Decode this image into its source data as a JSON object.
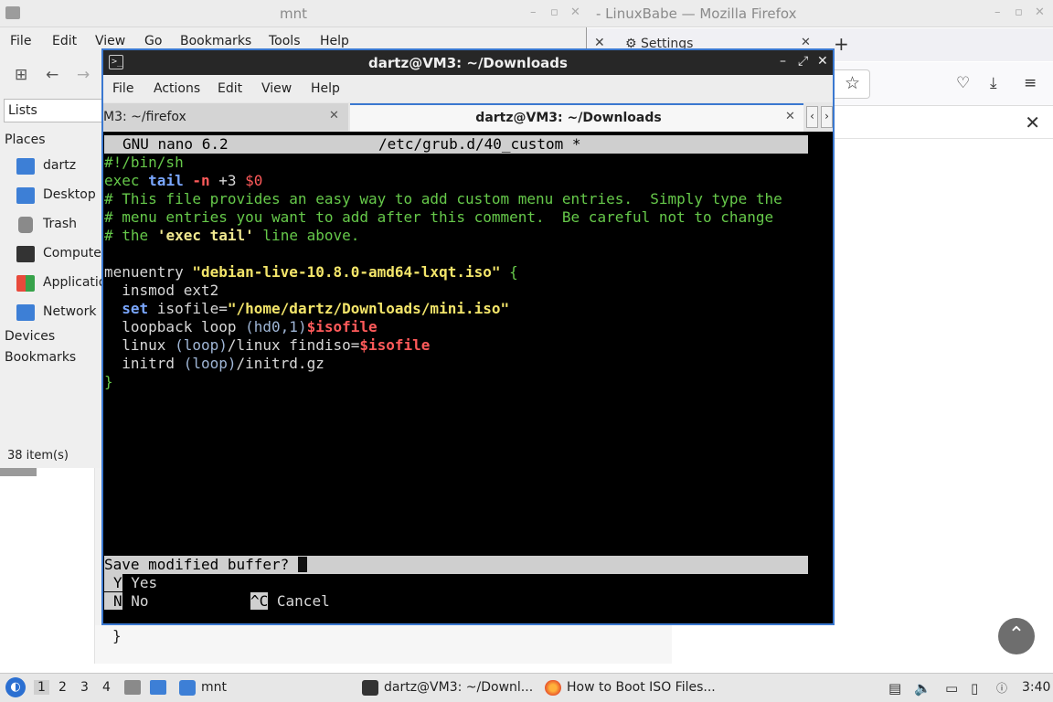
{
  "file_manager": {
    "title": "mnt",
    "menu": [
      "File",
      "Edit",
      "View",
      "Go",
      "Bookmarks",
      "Tools",
      "Help"
    ],
    "side_pane_mode": "Lists",
    "places_header": "Places",
    "places": [
      {
        "label": "dartz",
        "icon": "home-folder-icon"
      },
      {
        "label": "Desktop",
        "icon": "desktop-folder-icon"
      },
      {
        "label": "Trash",
        "icon": "trash-icon"
      },
      {
        "label": "Compute",
        "icon": "computer-icon"
      },
      {
        "label": "Applicatio",
        "icon": "applications-icon"
      },
      {
        "label": "Network",
        "icon": "network-folder-icon"
      }
    ],
    "devices_header": "Devices",
    "bookmarks_header": "Bookmarks",
    "status": "38 item(s)"
  },
  "firefox": {
    "title": "- LinuxBabe — Mozilla Firefox",
    "tab_label": "Settings"
  },
  "background_page": {
    "code_tail": "}"
  },
  "terminal": {
    "title": "dartz@VM3: ~/Downloads",
    "menu": [
      "File",
      "Actions",
      "Edit",
      "View",
      "Help"
    ],
    "tabs": [
      {
        "label": "M3: ~/firefox",
        "active": false
      },
      {
        "label": "dartz@VM3: ~/Downloads",
        "active": true
      }
    ],
    "nano": {
      "header_app": "GNU nano 6.2",
      "header_file": "/etc/grub.d/40_custom *",
      "lines": {
        "l1": "#!/bin/sh",
        "l2_kw": "exec",
        "l2_cmd": "tail",
        "l2_flag": "-n",
        "l2_arg": "+3",
        "l2_var": "$0",
        "l3": "# This file provides an easy way to add custom menu entries.  Simply type the",
        "l4": "# menu entries you want to add after this comment.  Be careful not to change",
        "l5_a": "# the",
        "l5_b": "'exec tail'",
        "l5_c": "line above.",
        "l7_kw": "menuentry",
        "l7_str": "\"debian-live-10.8.0-amd64-lxqt.iso\"",
        "l7_brace": "{",
        "l8": "  insmod ext2",
        "l9_kw": "set",
        "l9_a": "isofile=",
        "l9_str": "\"/home/dartz/Downloads/mini.iso\"",
        "l10_a": "  loopback loop",
        "l10_b": "(hd0,1)",
        "l10_var": "$isofile",
        "l11_a": "  linux",
        "l11_b": "(loop)",
        "l11_c": "/linux findiso=",
        "l11_var": "$isofile",
        "l12_a": "  initrd",
        "l12_b": "(loop)",
        "l12_c": "/initrd.gz",
        "l13": "}"
      },
      "prompt": "Save modified buffer?",
      "options": [
        {
          "key": "Y",
          "label": "Yes"
        },
        {
          "key": "N",
          "label": "No"
        },
        {
          "key": "^C",
          "label": "Cancel"
        }
      ]
    }
  },
  "taskbar": {
    "workspaces": [
      "1",
      "2",
      "3",
      "4"
    ],
    "tasks": [
      {
        "label": "mnt",
        "icon": "folder-icon"
      },
      {
        "label": "dartz@VM3: ~/Downl...",
        "icon": "terminal-icon"
      },
      {
        "label": "How to Boot ISO Files...",
        "icon": "firefox-icon"
      }
    ],
    "clock": "3:40"
  }
}
